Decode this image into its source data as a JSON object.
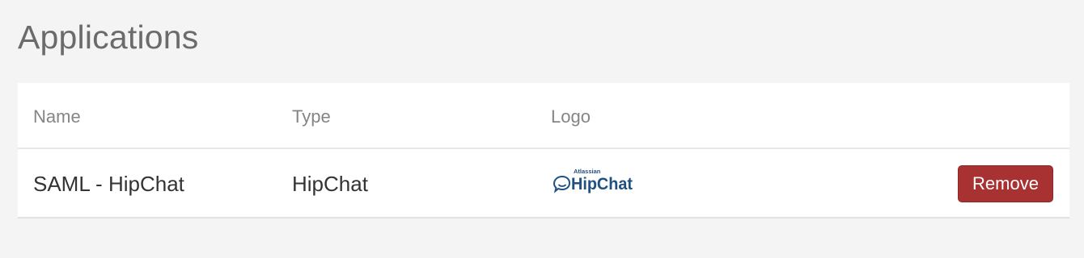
{
  "page": {
    "title": "Applications"
  },
  "table": {
    "columns": [
      "Name",
      "Type",
      "Logo"
    ],
    "rows": [
      {
        "name": "SAML - HipChat",
        "type": "HipChat",
        "logo": {
          "icon": "hipchat-logo",
          "small_text": "Atlassian",
          "text": "HipChat"
        },
        "action_label": "Remove"
      }
    ]
  },
  "colors": {
    "background": "#f4f4f4",
    "title": "#6b6b6b",
    "header_text": "#858585",
    "cell_text": "#333333",
    "remove_button": "#a83232",
    "logo_blue": "#205081"
  }
}
